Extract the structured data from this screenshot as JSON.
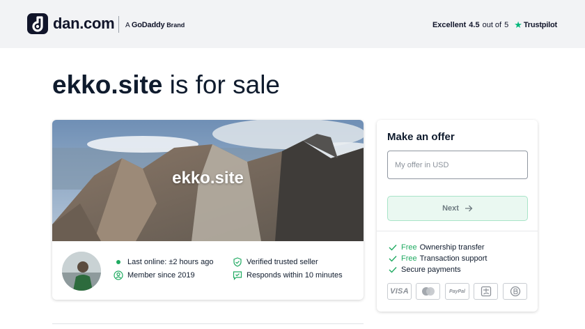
{
  "header": {
    "logo_text": "dan.com",
    "brand_prefix": "A",
    "brand_name": "GoDaddy",
    "brand_suffix": "Brand",
    "rating_label": "Excellent",
    "rating_value": "4.5",
    "rating_mid": "out of",
    "rating_max": "5",
    "trustpilot": "Trustpilot"
  },
  "headline": {
    "domain": "ekko.site",
    "suffix": " is for sale"
  },
  "listing": {
    "hero_domain": "ekko.site",
    "seller": {
      "last_online": "Last online: ±2 hours ago",
      "member_since": "Member since 2019",
      "verified": "Verified trusted seller",
      "responds": "Responds within 10 minutes"
    }
  },
  "offer": {
    "title": "Make an offer",
    "input_placeholder": "My offer in USD",
    "input_value": "",
    "next_label": "Next",
    "features": [
      {
        "free": "Free",
        "text": "Ownership transfer"
      },
      {
        "free": "Free",
        "text": "Transaction support"
      },
      {
        "free": "",
        "text": "Secure payments"
      }
    ],
    "payments": [
      {
        "icon": "visa-icon",
        "label": "VISA"
      },
      {
        "icon": "mastercard-icon",
        "label": ""
      },
      {
        "icon": "paypal-icon",
        "label": "PayPal"
      },
      {
        "icon": "alipay-icon",
        "label": ""
      },
      {
        "icon": "bitcoin-icon",
        "label": ""
      }
    ]
  },
  "colors": {
    "accent_green": "#1faa61",
    "trustpilot_green": "#00b67a",
    "header_bg": "#f2f3f5",
    "brand_dark": "#11152a"
  }
}
